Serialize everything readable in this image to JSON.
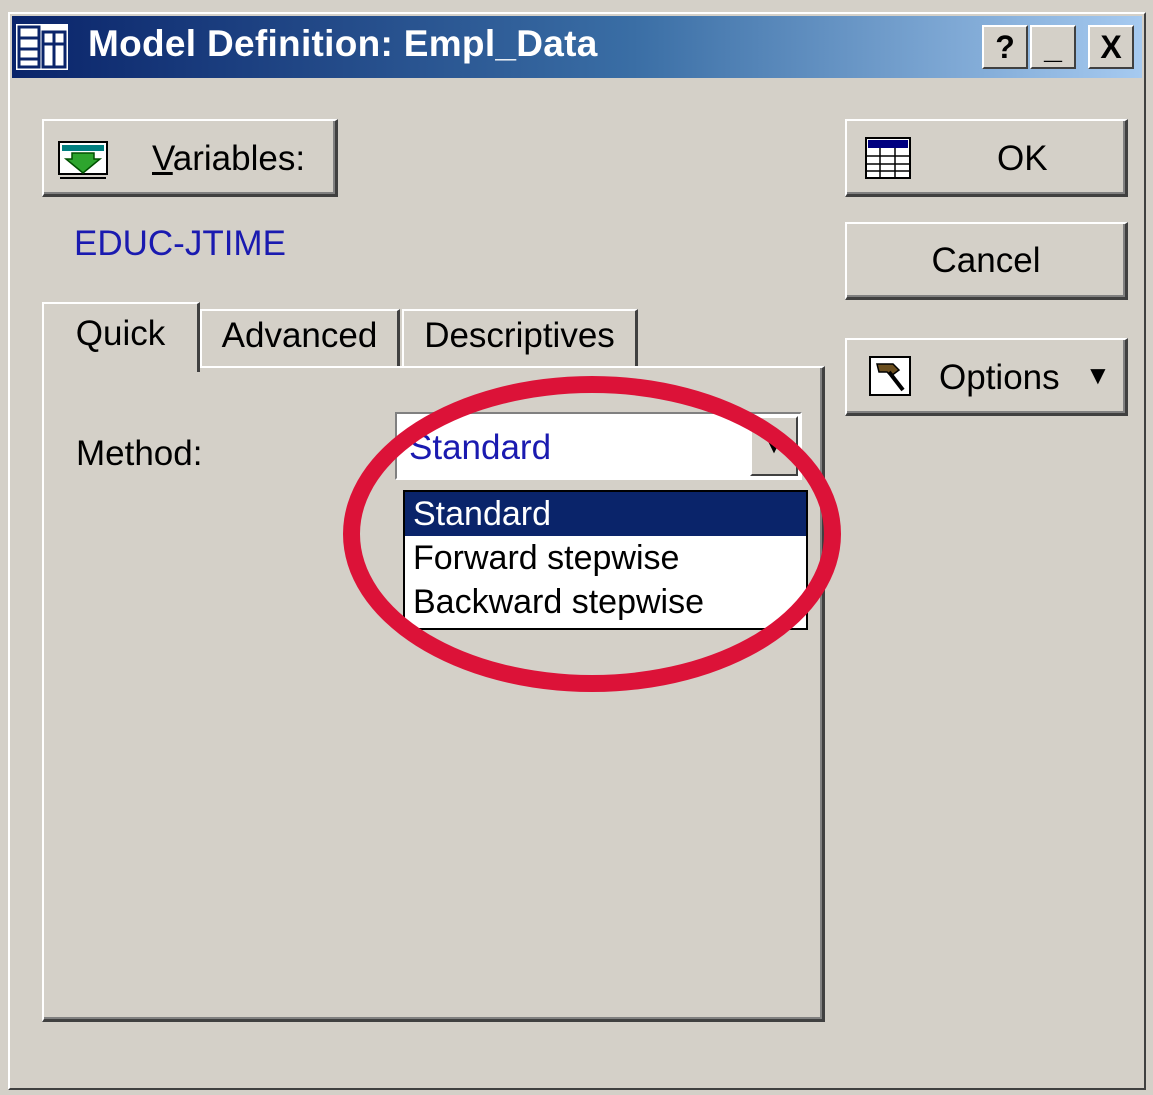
{
  "window": {
    "title": "Model Definition: Empl_Data",
    "caption_buttons": {
      "help": "?",
      "minimize": "_",
      "close": "X"
    }
  },
  "toolbar": {
    "variables_label": "Variables:",
    "variables_hotkey": "V",
    "variables_rest": "ariables:",
    "ok_label": "OK",
    "cancel_label": "Cancel",
    "options_label": "Options",
    "options_arrow": "▼"
  },
  "selected_variables": "EDUC-JTIME",
  "tabs": [
    {
      "label": "Quick",
      "active": true
    },
    {
      "label": "Advanced",
      "active": false
    },
    {
      "label": "Descriptives",
      "active": false
    }
  ],
  "method": {
    "label": "Method:",
    "label_hotkey": "M",
    "label_rest": "ethod:",
    "selected": "Standard",
    "options": [
      "Standard",
      "Forward stepwise",
      "Backward stepwise"
    ],
    "highlighted_index": 0,
    "dropdown_open": true
  },
  "annotation": {
    "highlight_color": "#dc1238"
  },
  "colors": {
    "dialog_bg": "#d4d0c8",
    "titlebar_start": "#0a246a",
    "selection": "#0a246a",
    "value_text": "#1a1ab0"
  },
  "icons": {
    "app": "statistica-app-icon",
    "variables": "variables-list-icon",
    "ok": "spreadsheet-icon",
    "options": "hammer-options-icon",
    "dropdown": "chevron-down-icon"
  }
}
